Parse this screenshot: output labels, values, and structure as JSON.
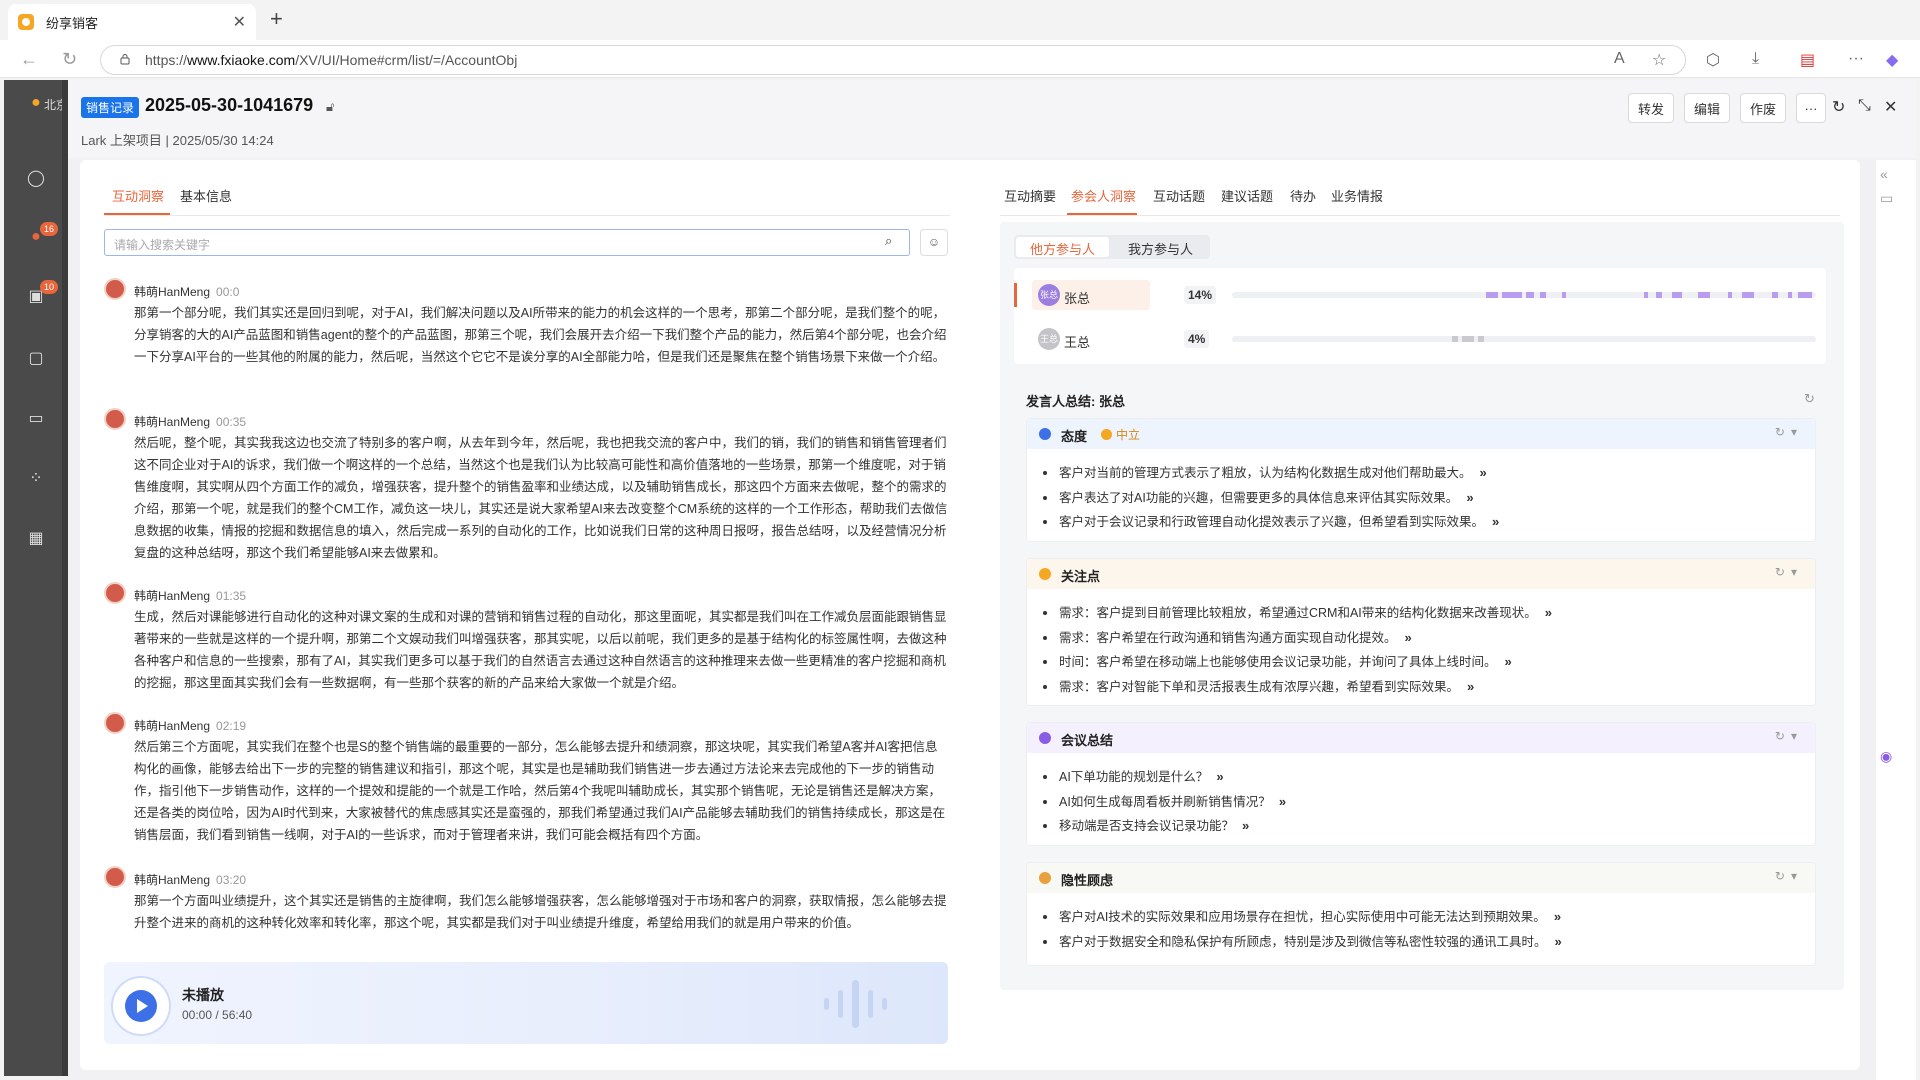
{
  "browser": {
    "tab_title": "纷享销客",
    "url_prefix": "https://",
    "url_host": "www.fxiaoke.com",
    "url_path": "/XV/UI/Home#crm/list/=/AccountObj"
  },
  "sidebar": {
    "org_label": "北京",
    "badge1": "16",
    "badge2": "10"
  },
  "header": {
    "tag": "销售记录",
    "title": "2025-05-30-1041679",
    "meta": "Lark 上架项目  |  2025/05/30 14:24",
    "buttons": {
      "forward": "转发",
      "edit": "编辑",
      "void": "作废"
    }
  },
  "left": {
    "tabs": {
      "insight": "互动洞察",
      "basic": "基本信息"
    },
    "search_placeholder": "请输入搜索关键字",
    "messages": [
      {
        "speaker": "韩萌HanMeng",
        "time": "00:0",
        "text": "那第一个部分呢，我们其实还是回归到呢，对于AI，我们解决问题以及AI所带来的能力的机会这样的一个思考，那第二个部分呢，是我们整个的呢，分享销客的大的AI产品蓝图和销售agent的整个的产品蓝图，那第三个呢，我们会展开去介绍一下我们整个产品的能力，然后第4个部分呢，也会介绍一下分享AI平台的一些其他的附属的能力，然后呢，当然这个它它不是诶分享的AI全部能力哈，但是我们还是聚焦在整个销售场景下来做一个介绍。"
      },
      {
        "speaker": "韩萌HanMeng",
        "time": "00:35",
        "text": "然后呢，整个呢，其实我我这边也交流了特别多的客户啊，从去年到今年，然后呢，我也把我交流的客户中，我们的销，我们的销售和销售管理者们这不同企业对于AI的诉求，我们做一个啊这样的一个总结，当然这个也是我们认为比较高可能性和高价值落地的一些场景，那第一个维度呢，对于销售维度啊，其实啊从四个方面工作的减负，增强获客，提升整个的销售盈率和业绩达成，以及辅助销售成长，那这四个方面来去做呢，整个的需求的介绍，那第一个呢，就是我们的整个CM工作，减负这一块儿，其实还是说大家希望AI来去改变整个CM系统的这样的一个工作形态，帮助我们去做信息数据的收集，情报的挖掘和数据信息的填入，然后完成一系列的自动化的工作，比如说我们日常的这种周日报呀，报告总结呀，以及经营情况分析复盘的这种总结呀，那这个我们希望能够AI来去做累和。"
      },
      {
        "speaker": "韩萌HanMeng",
        "time": "01:35",
        "text": "生成，然后对课能够进行自动化的这种对课文案的生成和对课的营销和销售过程的自动化，那这里面呢，其实都是我们叫在工作减负层面能跟销售显著带来的一些就是这样的一个提升啊，那第二个文娱动我们叫增强获客，那其实呢，以后以前呢，我们更多的是基于结构化的标签属性啊，去做这种各种客户和信息的一些搜索，那有了AI，其实我们更多可以基于我们的自然语言去通过这种自然语言的这种推理来去做一些更精准的客户挖掘和商机的挖掘，那这里面其实我们会有一些数据啊，有一些那个获客的新的产品来给大家做一个就是介绍。"
      },
      {
        "speaker": "韩萌HanMeng",
        "time": "02:19",
        "text": "然后第三个方面呢，其实我们在整个也是S的整个销售端的最重要的一部分，怎么能够去提升和绩洞察，那这块呢，其实我们希望A客并AI客把信息构化的画像，能够去给出下一步的完整的销售建议和指引，那这个呢，其实是也是辅助我们销售进一步去通过方法论来去完成他的下一步的销售动作，指引他下一步销售动作，这样的一个提效和提能的一个就是工作哈，然后第4个我呢叫辅助成长，其实那个销售呢，无论是销售还是解决方案，还是各类的岗位哈，因为AI时代到来，大家被替代的焦虑感其实还是蛮强的，那我们希望通过我们AI产品能够去辅助我们的销售持续成长，那这是在销售层面，我们看到销售一线啊，对于AI的一些诉求，而对于管理者来讲，我们可能会概括有四个方面。"
      },
      {
        "speaker": "韩萌HanMeng",
        "time": "03:20",
        "text": "那第一个方面叫业绩提升，这个其实还是销售的主旋律啊，我们怎么能够增强获客，怎么能够增强对于市场和客户的洞察，获取情报，怎么能够去提升整个进来的商机的这种转化效率和转化率，那这个呢，其实都是我们对于叫业绩提升维度，希望给用我们的就是用户带来的价值。"
      }
    ],
    "player": {
      "status": "未播放",
      "time": "00:00 / 56:40"
    }
  },
  "right": {
    "tabs": [
      "互动摘要",
      "参会人洞察",
      "互动话题",
      "建议话题",
      "待办",
      "业务情报"
    ],
    "active_tab": "参会人洞察",
    "segments": {
      "other": "他方参与人",
      "ours": "我方参与人"
    },
    "participants": [
      {
        "avatar": "张总",
        "name": "张总",
        "pct": "14%",
        "share": 0.14
      },
      {
        "avatar": "王总",
        "name": "王总",
        "pct": "4%",
        "share": 0.04
      }
    ],
    "summary_title": "发言人总结: 张总",
    "cards": [
      {
        "title": "态度",
        "badge": "中立",
        "items": [
          "客户对当前的管理方式表示了粗放，认为结构化数据生成对他们帮助最大。",
          "客户表达了对AI功能的兴趣，但需要更多的具体信息来评估其实际效果。",
          "客户对于会议记录和行政管理自动化提效表示了兴趣，但希望看到实际效果。"
        ]
      },
      {
        "title": "关注点",
        "items": [
          "需求：客户提到目前管理比较粗放，希望通过CRM和AI带来的结构化数据来改善现状。",
          "需求：客户希望在行政沟通和销售沟通方面实现自动化提效。",
          "时间：客户希望在移动端上也能够使用会议记录功能，并询问了具体上线时间。",
          "需求：客户对智能下单和灵活报表生成有浓厚兴趣，希望看到实际效果。"
        ]
      },
      {
        "title": "会议总结",
        "items": [
          "AI下单功能的规划是什么？",
          "AI如何生成每周看板并刷新销售情况？",
          "移动端是否支持会议记录功能？"
        ]
      },
      {
        "title": "隐性顾虑",
        "items": [
          "客户对AI技术的实际效果和应用场景存在担忧，担心实际使用中可能无法达到预期效果。",
          "客户对于数据安全和隐私保护有所顾虑，特别是涉及到微信等私密性较强的通讯工具时。"
        ]
      }
    ]
  },
  "colors": {
    "accent": "#e8663c",
    "brand": "#1a73e8"
  }
}
